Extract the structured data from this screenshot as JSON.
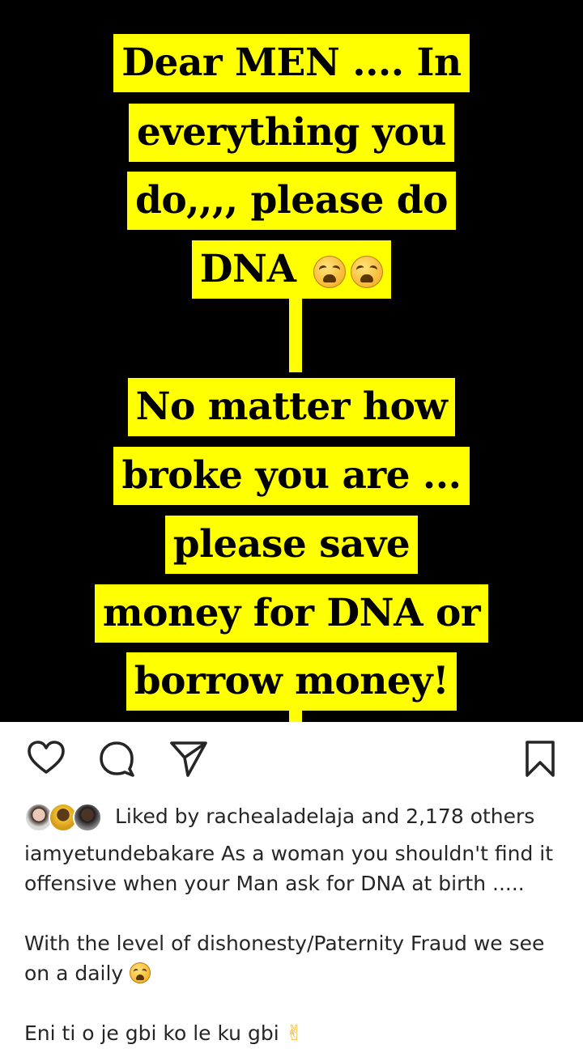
{
  "post_image": {
    "lines": [
      "Dear MEN .... In",
      "everything you",
      "do,,,, please do",
      "DNA",
      "No matter how",
      "broke you are ...",
      "please save",
      "money for DNA or",
      "borrow money!"
    ],
    "highlight_color": "#ffff00",
    "background_color": "#000000",
    "emoji": "weary-face-emoji"
  },
  "actions": {
    "like_icon": "heart-icon",
    "comment_icon": "comment-bubble-icon",
    "share_icon": "paper-plane-icon",
    "save_icon": "bookmark-icon"
  },
  "likes": {
    "prefix": "Liked by",
    "username": "rachealadelaja",
    "connector": "and",
    "others": "2,178 others"
  },
  "caption": {
    "author": "iamyetundebakare",
    "line1": "As a woman you shouldn't find it offensive when your Man ask for DNA at birth .....",
    "line2": "With the level of dishonesty/Paternity Fraud we see on a daily",
    "line3": "Eni ti o je gbi ko le ku gbi",
    "line3_emoji": "✌"
  }
}
